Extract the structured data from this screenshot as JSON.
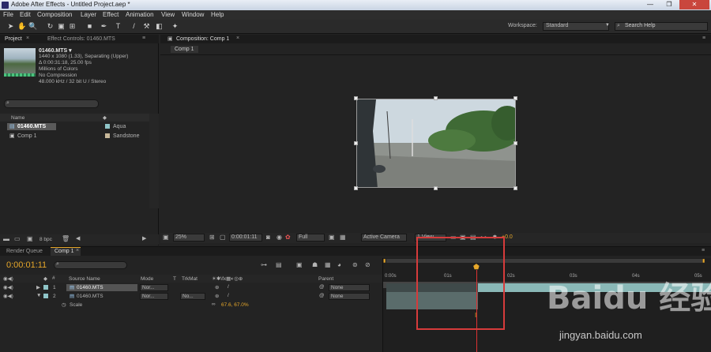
{
  "window": {
    "title": "Adobe After Effects - Untitled Project.aep *",
    "min": "—",
    "max": "❐",
    "close": "✕"
  },
  "menu": [
    "File",
    "Edit",
    "Composition",
    "Layer",
    "Effect",
    "Animation",
    "View",
    "Window",
    "Help"
  ],
  "toolbar": {
    "workspace_label": "Workspace:",
    "workspace_value": "Standard",
    "search_placeholder": "Search Help"
  },
  "project": {
    "tab": "Project",
    "effect_controls_tab": "Effect Controls: 01460.MTS",
    "footage_name": "01460.MTS ▾",
    "footage_info": [
      "1440 x 1080 (1.33), Separating (Upper)",
      "Δ 0:00:31:18, 25.00 fps",
      "Millions of Colors",
      "No Compression",
      "48.000 kHz / 32 bit U / Stereo"
    ],
    "col_name": "Name",
    "col_type": "Ty",
    "items": [
      {
        "name": "01460.MTS",
        "label": "Aqua",
        "color": "#8fc5c8"
      },
      {
        "name": "Comp 1",
        "label": "Sandstone",
        "color": "#c8b89a"
      }
    ],
    "bpc": "8 bpc"
  },
  "composition": {
    "tab": "Composition: Comp 1",
    "subtab": "Comp 1",
    "zoom": "25%",
    "timecode": "0:00:01:11",
    "resolution": "Full",
    "camera": "Active Camera",
    "views": "1 View",
    "exposure": "+0.0"
  },
  "timeline": {
    "tabs": [
      "Render Queue",
      "Comp 1"
    ],
    "timecode": "0:00:01:11",
    "headers": {
      "source": "Source Name",
      "mode": "Mode",
      "t": "T",
      "trkmat": "TrkMat",
      "parent": "Parent"
    },
    "layers": [
      {
        "num": "1",
        "name": "01460.MTS",
        "mode": "Nor...",
        "trkmat": "",
        "parent": "None"
      },
      {
        "num": "2",
        "name": "01460.MTS",
        "mode": "Nor...",
        "trkmat": "No...",
        "parent": "None"
      }
    ],
    "scale_label": "Scale",
    "scale_value": "67.6, 67.0%",
    "ruler": [
      "0:00s",
      "01s",
      "02s",
      "03s",
      "04s",
      "05s"
    ]
  },
  "watermark": {
    "brand": "Baidu 经验",
    "url": "jingyan.baidu.com"
  }
}
